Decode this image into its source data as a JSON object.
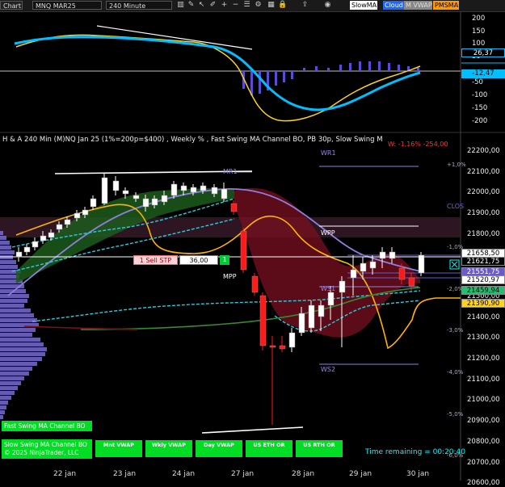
{
  "toolbar": {
    "tab_label": "Chart",
    "instrument": "MNQ MAR25",
    "interval": "240 Minute",
    "buttons": [
      {
        "label": "SlowMA",
        "bg": "#ffffff",
        "fg": "#000000"
      },
      {
        "label": "Cloud",
        "bg": "#1e66ff",
        "fg": "#ffffff"
      },
      {
        "label": "M VWAP",
        "bg": "#888888",
        "fg": "#dddddd"
      },
      {
        "label": "PMSMA",
        "bg": "#ff9900",
        "fg": "#000000"
      }
    ],
    "icons": [
      "chart-type-icon",
      "draw-tools-icon",
      "cursor-icon",
      "pencil-icon",
      "zoom-in-icon",
      "zoom-out-icon",
      "properties-icon",
      "strategy-icon",
      "data-box-icon",
      "lock-icon",
      "share-icon",
      "camera-icon"
    ]
  },
  "oscillator": {
    "axis_ticks": [
      "200",
      "150",
      "100",
      "50",
      "-50",
      "-100",
      "-150",
      "-200"
    ],
    "value_fast": "26,37",
    "value_slow": "-12,47",
    "colors": {
      "fast": "#00bfff",
      "slow": "#ffd21f",
      "hist": "#5b4bd6"
    }
  },
  "price_panel": {
    "header": "H & A 240 Min (M)NQ Jan 25  (1%=200p=$400) , Weekly % , Fast Swing MA Channel BO, PB 30p, Slow Swing MA Channel BO, Wkly TPO",
    "header_right": "W: -1,16% -254,00",
    "axis_ticks": [
      "22200,00",
      "22100,00",
      "22000,00",
      "21900,00",
      "21800,00",
      "21700,00",
      "21600,00",
      "21500,00",
      "21400,00",
      "21300,00",
      "21200,00",
      "21100,00",
      "21000,00",
      "20900,00",
      "20800,00",
      "20700,00",
      "20600,00"
    ],
    "pct_labels": [
      "+1,0%",
      "-1,0%",
      "-2,0%",
      "-3,0%",
      "-4,0%",
      "-5,0%",
      "-6,0%"
    ],
    "levels": {
      "wr1": "WR1",
      "mr1": "MR1",
      "wpp": "WPP",
      "mpp": "MPP",
      "ws1": "WS1",
      "ws2": "WS2",
      "close": "CLOS"
    },
    "order": {
      "label": "1  Sell STP",
      "qty": "36,00",
      "count": "1"
    },
    "price_tags": [
      {
        "value": "21658,50",
        "bg": "#ffffff",
        "fg": "#000000"
      },
      {
        "value": "21621,75",
        "bg": "#000000",
        "fg": "#ffffff"
      },
      {
        "value": "21551,75",
        "bg": "#6a5acd",
        "fg": "#ffffff"
      },
      {
        "value": "21520,97",
        "bg": "#ffffff",
        "fg": "#000000"
      },
      {
        "value": "21459,94",
        "bg": "#20c070",
        "fg": "#000000"
      },
      {
        "value": "21390,90",
        "bg": "#ffd21f",
        "fg": "#000000"
      }
    ],
    "legend": {
      "fast": "Fast Swing MA Channel BO",
      "slow": "Slow Swing MA Channel BO",
      "copyright": "© 2025 NinjaTrader, LLC"
    },
    "bottom_buttons": [
      "Mnt VWAP",
      "Wkly VWAP",
      "Day VWAP",
      "US ETH OR",
      "US RTH OR"
    ],
    "time_remaining": "Time remaining = 00:20:40"
  },
  "time_axis": [
    "22 jan",
    "23 jan",
    "24 jan",
    "27 jan",
    "28 jan",
    "29 jan",
    "30 jan"
  ]
}
